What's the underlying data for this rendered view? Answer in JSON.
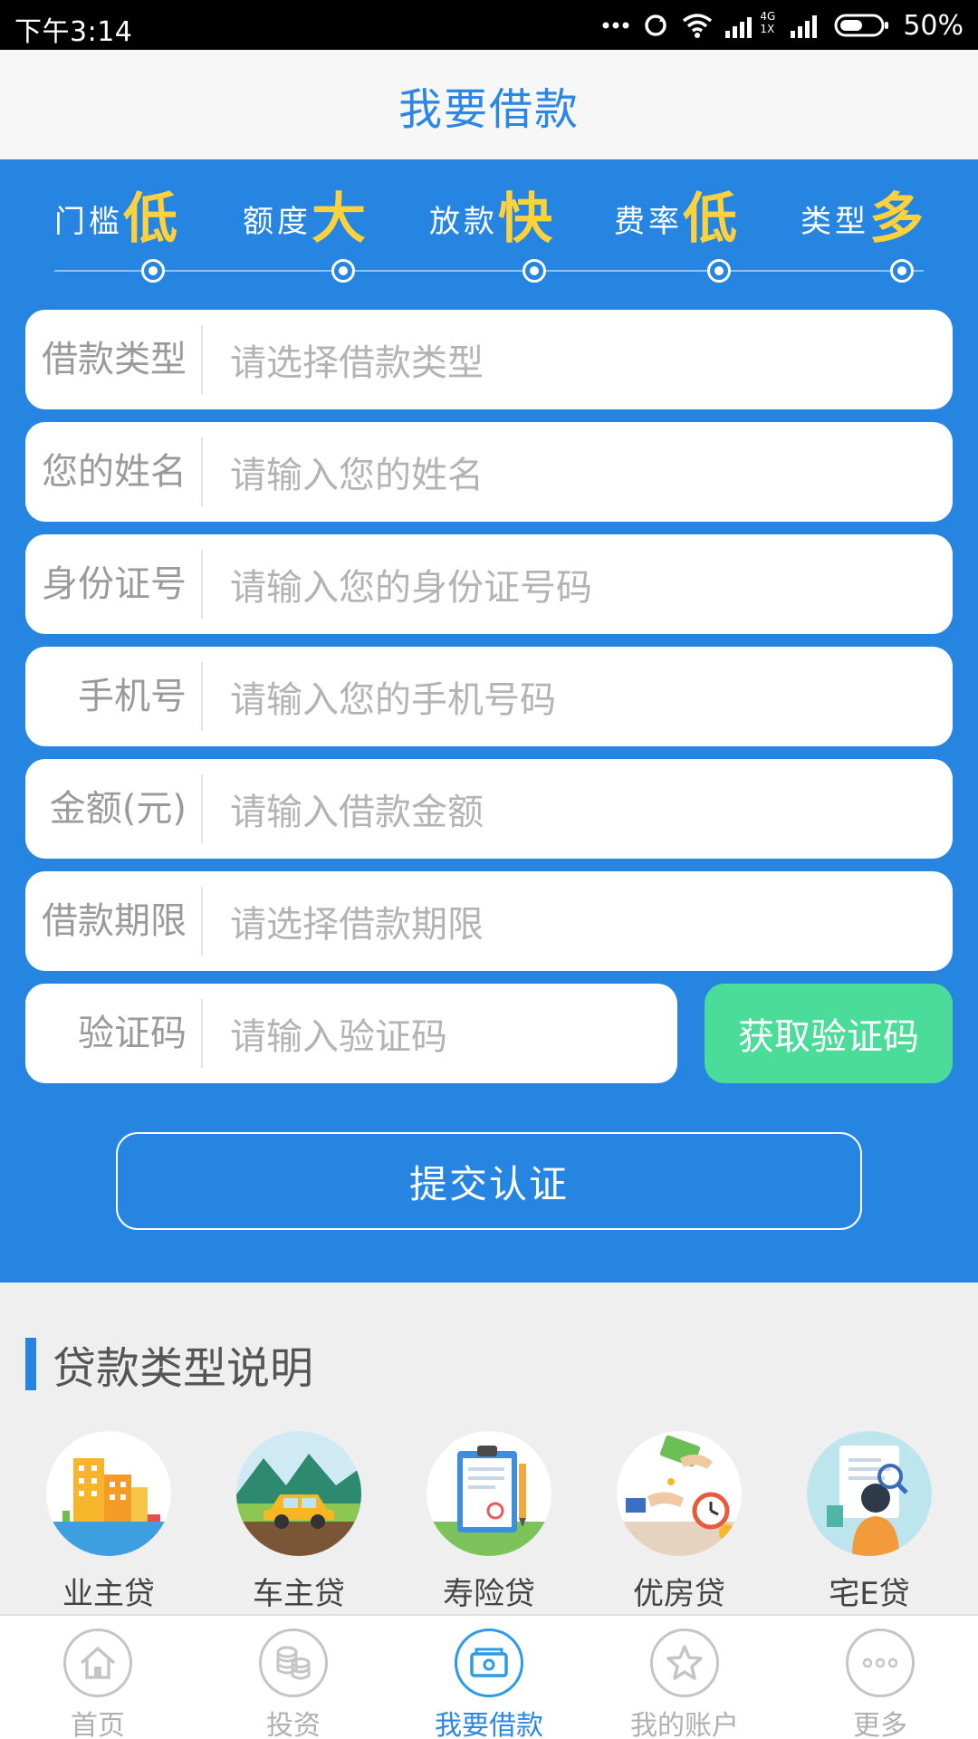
{
  "status_bar": {
    "time": "下午3:14",
    "battery": "50%",
    "net_top": "4G",
    "net_bottom": "1X"
  },
  "header": {
    "title": "我要借款"
  },
  "features": [
    {
      "small": "门槛",
      "big": "低"
    },
    {
      "small": "额度",
      "big": "大"
    },
    {
      "small": "放款",
      "big": "快"
    },
    {
      "small": "费率",
      "big": "低"
    },
    {
      "small": "类型",
      "big": "多"
    }
  ],
  "form": {
    "fields": [
      {
        "label": "借款类型",
        "placeholder": "请选择借款类型"
      },
      {
        "label": "您的姓名",
        "placeholder": "请输入您的姓名"
      },
      {
        "label": "身份证号",
        "placeholder": "请输入您的身份证号码"
      },
      {
        "label": "手机号",
        "placeholder": "请输入您的手机号码"
      },
      {
        "label": "金额(元)",
        "placeholder": "请输入借款金额"
      },
      {
        "label": "借款期限",
        "placeholder": "请选择借款期限"
      },
      {
        "label": "验证码",
        "placeholder": "请输入验证码"
      }
    ],
    "get_code_label": "获取验证码",
    "submit_label": "提交认证"
  },
  "loan_section": {
    "title": "贷款类型说明",
    "types": [
      {
        "label": "业主贷",
        "icon": "building-icon"
      },
      {
        "label": "车主贷",
        "icon": "car-icon"
      },
      {
        "label": "寿险贷",
        "icon": "clipboard-icon"
      },
      {
        "label": "优房贷",
        "icon": "money-clock-icon"
      },
      {
        "label": "宅E贷",
        "icon": "person-search-icon"
      }
    ]
  },
  "tabs": [
    {
      "label": "首页",
      "icon": "home-icon",
      "active": false
    },
    {
      "label": "投资",
      "icon": "coins-icon",
      "active": false
    },
    {
      "label": "我要借款",
      "icon": "wallet-icon",
      "active": true
    },
    {
      "label": "我的账户",
      "icon": "star-icon",
      "active": false
    },
    {
      "label": "更多",
      "icon": "more-icon",
      "active": false
    }
  ],
  "colors": {
    "primary": "#2785e2",
    "accent_yellow": "#ffd23c",
    "code_button": "#4cdc9a"
  }
}
